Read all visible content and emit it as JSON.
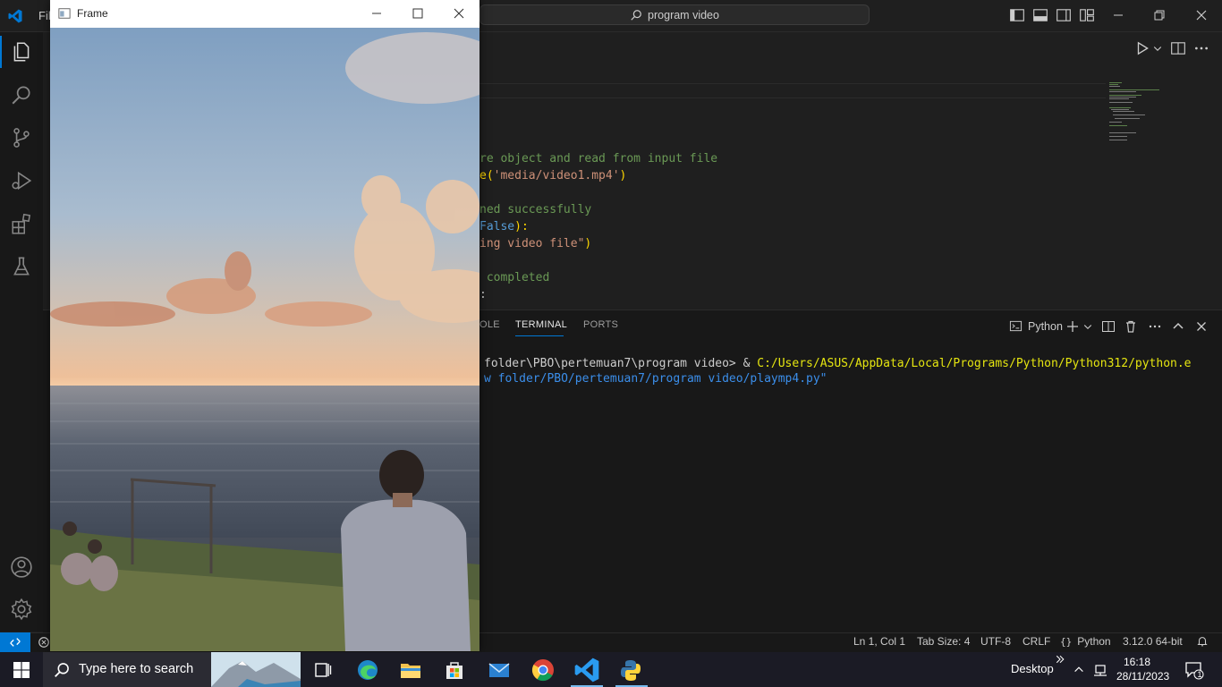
{
  "app": {
    "menu_file": "Fil",
    "command_center": "program video",
    "accent": "#0078d4"
  },
  "activity_bar": {
    "items": [
      "explorer-icon",
      "search-icon",
      "source-control-icon",
      "run-debug-icon",
      "extensions-icon",
      "testing-icon"
    ],
    "bottom": [
      "accounts-icon",
      "manage-gear-icon"
    ]
  },
  "editor": {
    "lines": [
      {
        "parts": [
          {
            "t": "re object and read from input file",
            "c": "comment"
          }
        ]
      },
      {
        "parts": [
          {
            "t": "e",
            "c": "paren"
          },
          {
            "t": "(",
            "c": "paren"
          },
          {
            "t": "'media/video1.mp4'",
            "c": "string"
          },
          {
            "t": ")",
            "c": "paren"
          }
        ]
      },
      {
        "parts": []
      },
      {
        "parts": [
          {
            "t": "ned successfully",
            "c": "comment"
          }
        ]
      },
      {
        "parts": [
          {
            "t": "False",
            "c": "keyword"
          },
          {
            "t": "):",
            "c": "paren"
          }
        ]
      },
      {
        "parts": [
          {
            "t": "ing video file\"",
            "c": "string"
          },
          {
            "t": ")",
            "c": "paren"
          }
        ]
      },
      {
        "parts": []
      },
      {
        "parts": [
          {
            "t": " completed",
            "c": "comment"
          }
        ]
      },
      {
        "parts": [
          {
            "t": ":",
            "c": "plain"
          }
        ]
      }
    ]
  },
  "panel": {
    "tabs": [
      "OLE",
      "TERMINAL",
      "PORTS"
    ],
    "active_tab": "TERMINAL",
    "terminal_profile": "Python",
    "terminal_lines": [
      {
        "plain": "folder\\PBO\\pertemuan7\\program video> & ",
        "highlight": "C:/Users/ASUS/AppData/Local/Programs/Python/Python312/python.e"
      },
      {
        "plain": "",
        "highlight": "w folder/PBO/pertemuan7/program video/playmp4.py\""
      }
    ]
  },
  "statusbar": {
    "position": "Ln 1, Col 1",
    "tab_size": "Tab Size: 4",
    "encoding": "UTF-8",
    "eol": "CRLF",
    "language": "Python",
    "interpreter": "3.12.0 64-bit"
  },
  "frame_window": {
    "title": "Frame"
  },
  "taskbar": {
    "search_placeholder": "Type here to search",
    "apps": [
      "task-view-icon",
      "edge-icon",
      "file-explorer-icon",
      "store-icon",
      "mail-icon",
      "chrome-icon",
      "vscode-icon",
      "python-icon"
    ],
    "desktop_label": "Desktop",
    "time": "16:18",
    "date": "28/11/2023",
    "notification_count": "1"
  }
}
